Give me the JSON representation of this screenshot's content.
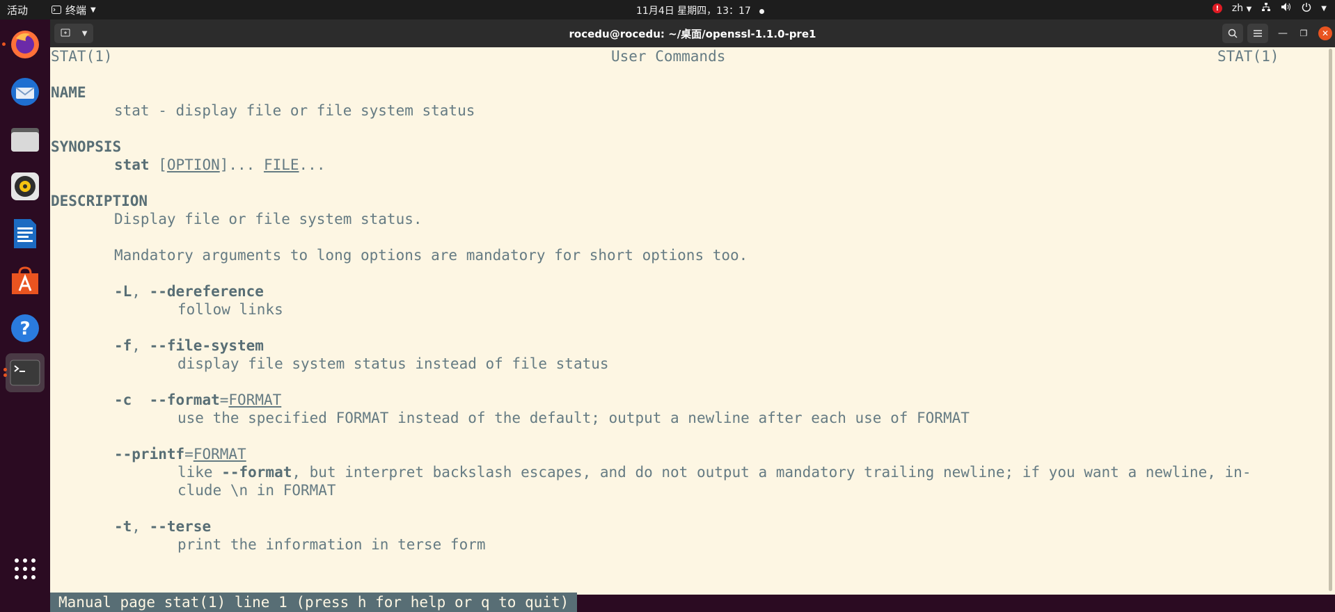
{
  "topbar": {
    "activities": "活动",
    "app_name": "终端",
    "clock": "11月4日 星期四，13：17",
    "input_method": "zh",
    "alert_badge": "!"
  },
  "window": {
    "title": "rocedu@rocedu: ~/桌面/openssl-1.1.0-pre1"
  },
  "man": {
    "header_left": "STAT(1)",
    "header_center": "User Commands",
    "header_right": "STAT(1)",
    "name_heading": "NAME",
    "name_text": "stat - display file or file system status",
    "synopsis_heading": "SYNOPSIS",
    "synopsis_cmd": "stat",
    "synopsis_bracket_open": " [",
    "synopsis_option": "OPTION",
    "synopsis_mid": "]... ",
    "synopsis_file": "FILE",
    "synopsis_end": "...",
    "description_heading": "DESCRIPTION",
    "desc_line1": "Display file or file system status.",
    "desc_line2": "Mandatory arguments to long options are mandatory for short options too.",
    "opt1_short": "-L",
    "opt1_sep": ", ",
    "opt1_long": "--dereference",
    "opt1_desc": "follow links",
    "opt2_short": "-f",
    "opt2_sep": ", ",
    "opt2_long": "--file-system",
    "opt2_desc": "display file system status instead of file status",
    "opt3_short": "-c",
    "opt3_sep": "  ",
    "opt3_long": "--format",
    "opt3_eq": "=",
    "opt3_arg": "FORMAT",
    "opt3_desc": "use the specified FORMAT instead of the default; output a newline after each use of FORMAT",
    "opt4_long": "--printf",
    "opt4_eq": "=",
    "opt4_arg": "FORMAT",
    "opt4_desc_a": "like ",
    "opt4_desc_bold": "--format",
    "opt4_desc_b": ", but interpret backslash escapes, and do not output a mandatory trailing newline; if you want a newline, in-",
    "opt4_desc_line2": "clude \\n in FORMAT",
    "opt5_short": "-t",
    "opt5_sep": ", ",
    "opt5_long": "--terse",
    "opt5_desc": "print the information in terse form"
  },
  "status_line": "Manual page stat(1) line 1 (press h for help or q to quit)",
  "colors": {
    "terminal_bg": "#fdf6e3",
    "terminal_fg": "#657b83",
    "accent": "#e95420"
  }
}
